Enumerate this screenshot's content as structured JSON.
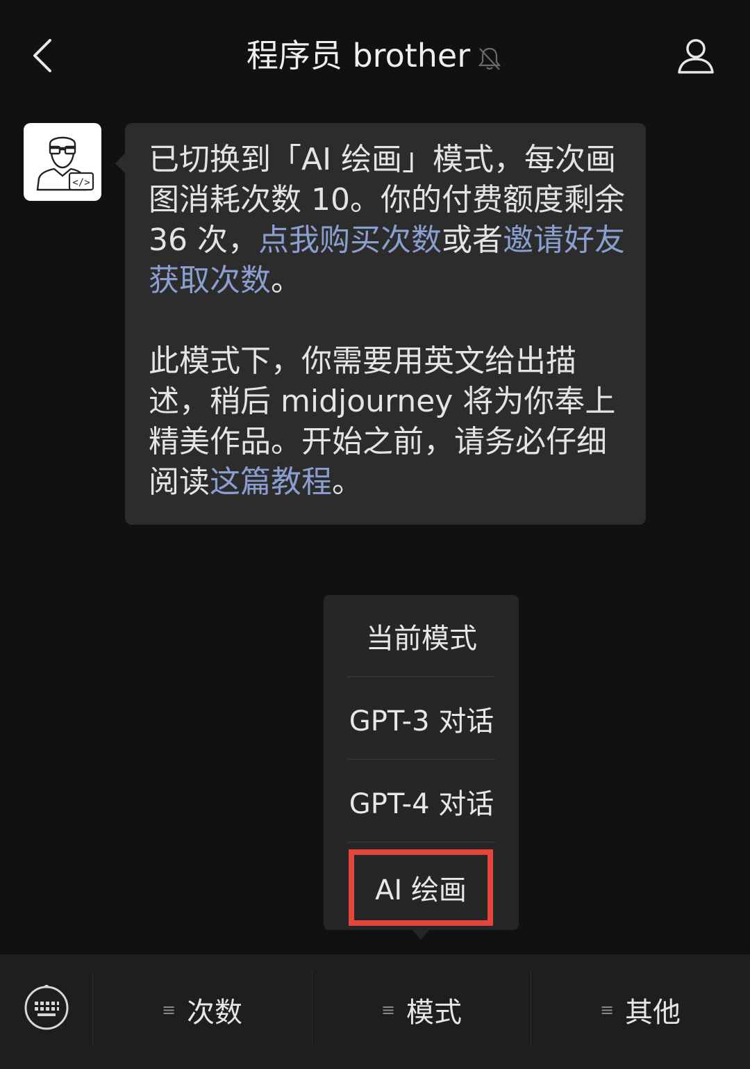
{
  "header": {
    "title": "程序员 brother",
    "back_icon": "chevron-left-icon",
    "mute_icon": "bell-off-icon",
    "profile_icon": "person-icon"
  },
  "message": {
    "avatar_icon": "programmer-avatar-icon",
    "avatar_code_text": "</>",
    "p1_text_a": "已切换到「AI 绘画」模式，每次画图消耗次数 10。你的付费额度剩余 36 次，",
    "p1_link_buy": "点我购买次数",
    "p1_text_b": "或者",
    "p1_link_invite": "邀请好友获取次数",
    "p1_end": "。",
    "p2_text": "此模式下，你需要用英文给出描述，稍后 midjourney 将为你奉上精美作品。开始之前，请务必仔细阅读",
    "p2_link": "这篇教程",
    "p2_end": "。",
    "link_color": "#8a9fd0"
  },
  "menu": {
    "items": [
      {
        "label": "当前模式"
      },
      {
        "label": "GPT-3 对话"
      },
      {
        "label": "GPT-4 对话"
      },
      {
        "label": "AI 绘画",
        "selected": true
      }
    ],
    "highlight_color": "#e5463b"
  },
  "bottom_bar": {
    "keyboard_icon": "keyboard-icon",
    "tabs": [
      {
        "icon": "≡",
        "label": "次数"
      },
      {
        "icon": "≡",
        "label": "模式"
      },
      {
        "icon": "≡",
        "label": "其他"
      }
    ]
  }
}
